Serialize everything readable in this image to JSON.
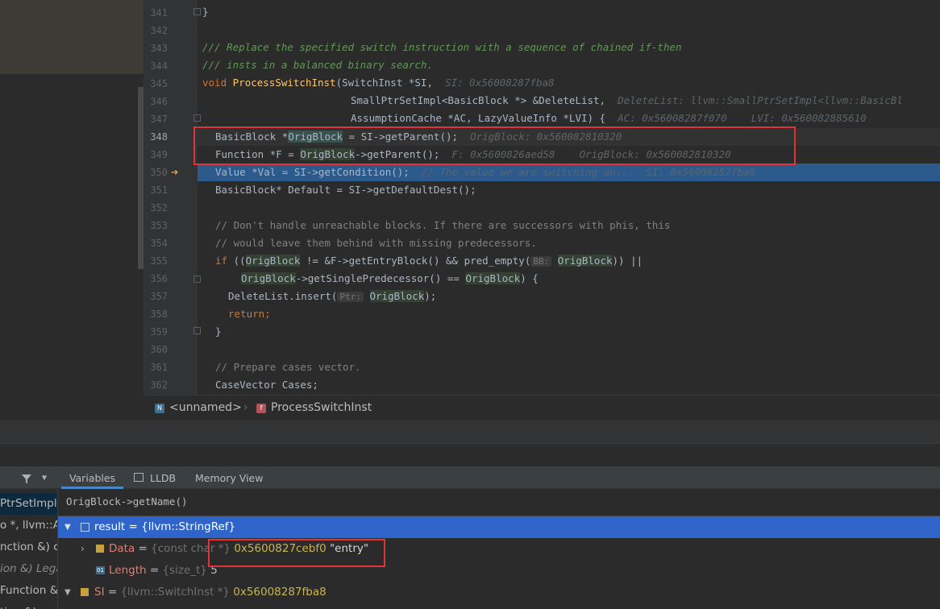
{
  "editor": {
    "lines": [
      {
        "num": "341",
        "current": false
      },
      {
        "num": "342",
        "current": false
      },
      {
        "num": "343",
        "current": false
      },
      {
        "num": "344",
        "current": false
      },
      {
        "num": "345",
        "current": false
      },
      {
        "num": "346",
        "current": false
      },
      {
        "num": "347",
        "current": false
      },
      {
        "num": "348",
        "current": true
      },
      {
        "num": "349",
        "current": false
      },
      {
        "num": "350",
        "current": false
      },
      {
        "num": "351",
        "current": false
      },
      {
        "num": "352",
        "current": false
      },
      {
        "num": "353",
        "current": false
      },
      {
        "num": "354",
        "current": false
      },
      {
        "num": "355",
        "current": false
      },
      {
        "num": "356",
        "current": false
      },
      {
        "num": "357",
        "current": false
      },
      {
        "num": "358",
        "current": false
      },
      {
        "num": "359",
        "current": false
      },
      {
        "num": "360",
        "current": false
      },
      {
        "num": "361",
        "current": false
      },
      {
        "num": "362",
        "current": false
      }
    ],
    "code": {
      "l341": "}",
      "l343": "/// Replace the specified switch instruction with a sequence of chained if-then",
      "l344": "/// insts in a balanced binary search.",
      "l345_kw": "void",
      "l345_fn": "ProcessSwitchInst",
      "l345_rest": "(SwitchInst *SI,",
      "l345_hint": "SI: 0x56008287fba8",
      "l346": "SmallPtrSetImpl<BasicBlock *> &DeleteList,",
      "l346_hint": "DeleteList: llvm::SmallPtrSetImpl<llvm::BasicBl",
      "l347": "AssumptionCache *AC, LazyValueInfo *LVI) {",
      "l347_hint1": "AC: 0x56008287f070",
      "l347_hint2": "LVI: 0x560082885610",
      "l348_a": "BasicBlock *",
      "l348_var": "OrigBlock",
      "l348_b": " = SI->getParent();",
      "l348_hint": "OrigBlock: 0x560082810320",
      "l349_a": "Function *F = ",
      "l349_var": "OrigBlock",
      "l349_b": "->getParent();",
      "l349_hint1": "F: 0x5600826aed58",
      "l349_hint2": "OrigBlock: 0x560082810320",
      "l350": "Value *Val = SI->getCondition();",
      "l350_cm": "// The value we are switching on...",
      "l350_hint": "SI: 0x56008287fba8",
      "l351": "BasicBlock* Default = SI->getDefaultDest();",
      "l353": "// Don't handle unreachable blocks. If there are successors with phis, this",
      "l354": "// would leave them behind with missing predecessors.",
      "l355_kw": "if",
      "l355_a": " ((",
      "l355_var1": "OrigBlock",
      "l355_b": " != &F->getEntryBlock() && pred_empty(",
      "l355_ph": "BB:",
      "l355_var2": "OrigBlock",
      "l355_c": ")) ||",
      "l356_var1": "OrigBlock",
      "l356_a": "->getSinglePredecessor() == ",
      "l356_var2": "OrigBlock",
      "l356_b": ") {",
      "l357_a": "DeleteList.insert(",
      "l357_ph": "Ptr:",
      "l357_var": "OrigBlock",
      "l357_b": ");",
      "l358": "return;",
      "l359": "}",
      "l361": "// Prepare cases vector.",
      "l362": "CaseVector Cases;"
    }
  },
  "breadcrumb": {
    "ns_badge": "N",
    "ns": "<unnamed>",
    "fn_badge": "f",
    "fn": "ProcessSwitchInst"
  },
  "debugger": {
    "tabs": {
      "variables": "Variables",
      "lldb": "LLDB",
      "memory": "Memory View"
    },
    "frames": [
      "PtrSetImpl<",
      "o *, llvm::As",
      "nction &) c",
      "ion &) Lega",
      "Function &",
      "tion &) ..."
    ],
    "expression": "OrigBlock->getName()",
    "variables": {
      "result_name": "result",
      "result_eq": " = ",
      "result_type": "{llvm::StringRef}",
      "data_name": "Data",
      "data_eq": " = ",
      "data_type": "{const char *}",
      "data_addr": "0x5600827cebf0",
      "data_str": "\"entry\"",
      "length_name": "Length",
      "length_eq": " = ",
      "length_type": "{size_t}",
      "length_val": "5",
      "si_name": "SI",
      "si_eq": " = ",
      "si_type": "{llvm::SwitchInst *}",
      "si_val": "0x56008287fba8"
    }
  },
  "colors": {
    "accent_selection": "#2f65ca",
    "execution_line": "#2d5a8c",
    "highlight_box": "#e2323a"
  }
}
